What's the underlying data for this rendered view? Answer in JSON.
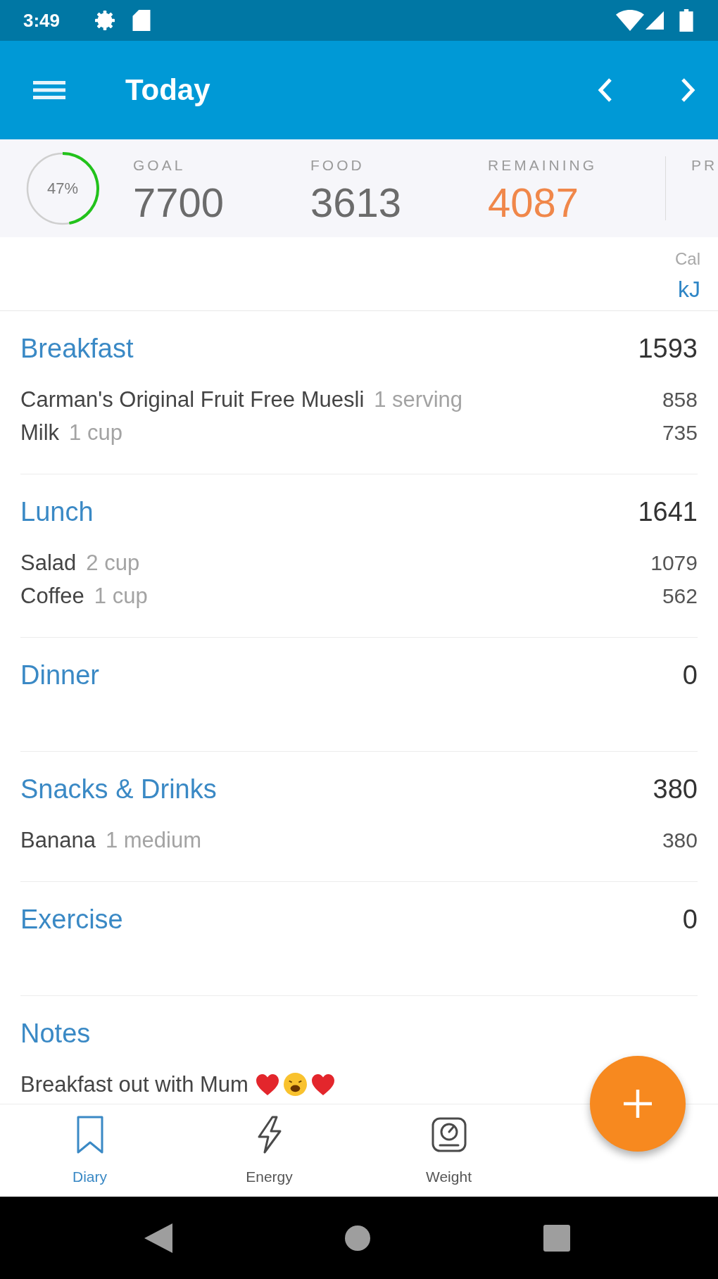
{
  "status_bar": {
    "time": "3:49"
  },
  "app_bar": {
    "title": "Today"
  },
  "summary": {
    "progress": {
      "level": 0.47,
      "label": "47%"
    },
    "stats": [
      {
        "label": "GOAL",
        "value": "7700",
        "color": "#6b6b6b"
      },
      {
        "label": "FOOD",
        "value": "3613",
        "color": "#6b6b6b"
      },
      {
        "label": "REMAINING",
        "value": "4087",
        "color": "#f0874a"
      }
    ],
    "column_4": {
      "label": "PR"
    }
  },
  "units": [
    {
      "label": "Cal",
      "selected": false
    },
    {
      "label": "kJ",
      "selected": true
    }
  ],
  "meals": [
    {
      "name": "Breakfast",
      "total": "1593",
      "items": [
        {
          "name": "Carman's Original Fruit Free Muesli",
          "amount": "1 serving",
          "value": "858"
        },
        {
          "name": "Milk",
          "amount": "1 cup",
          "value": "735"
        }
      ]
    },
    {
      "name": "Lunch",
      "total": "1641",
      "items": [
        {
          "name": "Salad",
          "amount": "2 cup",
          "value": "1079"
        },
        {
          "name": "Coffee",
          "amount": "1 cup",
          "value": "562"
        }
      ]
    },
    {
      "name": "Dinner",
      "total": "0"
    },
    {
      "name": "Snacks & Drinks",
      "total": "380",
      "items": [
        {
          "name": "Banana",
          "amount": "1 medium",
          "value": "380"
        }
      ]
    },
    {
      "name": "Exercise",
      "total": "0"
    }
  ],
  "notes": {
    "title": "Notes",
    "text": "Breakfast out with Mum"
  },
  "bottom_nav": [
    {
      "label": "Diary",
      "selected": true
    },
    {
      "label": "Energy",
      "selected": false
    },
    {
      "label": "Weight",
      "selected": false
    }
  ]
}
